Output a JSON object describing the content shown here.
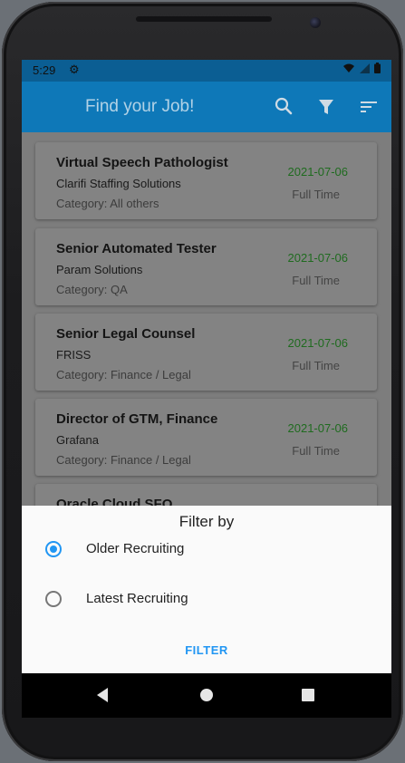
{
  "status_bar": {
    "time": "5:29",
    "settings_icon": "gear-icon",
    "wifi_icon": "wifi-icon",
    "signal_icon": "signal-icon",
    "battery_icon": "battery-icon"
  },
  "app_bar": {
    "title": "Find your Job!",
    "actions": [
      {
        "icon": "search-icon"
      },
      {
        "icon": "filter-icon"
      },
      {
        "icon": "sort-icon"
      }
    ],
    "color": "#0e78b8"
  },
  "jobs": [
    {
      "title": "Virtual Speech Pathologist",
      "company": "Clarifi Staffing Solutions",
      "category": "Category: All others",
      "date": "2021-07-06",
      "type": "Full Time"
    },
    {
      "title": "Senior Automated Tester",
      "company": "Param Solutions",
      "category": "Category: QA",
      "date": "2021-07-06",
      "type": "Full Time"
    },
    {
      "title": "Senior Legal Counsel",
      "company": "FRISS",
      "category": "Category: Finance / Legal",
      "date": "2021-07-06",
      "type": "Full Time"
    },
    {
      "title": "Director of GTM, Finance",
      "company": "Grafana",
      "category": "Category: Finance / Legal",
      "date": "2021-07-06",
      "type": "Full Time"
    },
    {
      "title": "Oracle Cloud SFO"
    }
  ],
  "filter_sheet": {
    "heading": "Filter by",
    "options": [
      {
        "label": "Older Recruiting",
        "selected": true
      },
      {
        "label": "Latest Recruiting",
        "selected": false
      }
    ],
    "action_label": "FILTER",
    "accent": "#2196f3"
  },
  "nav_bar": {
    "back_icon": "back-icon",
    "home_icon": "home-icon",
    "recents_icon": "recents-icon"
  }
}
